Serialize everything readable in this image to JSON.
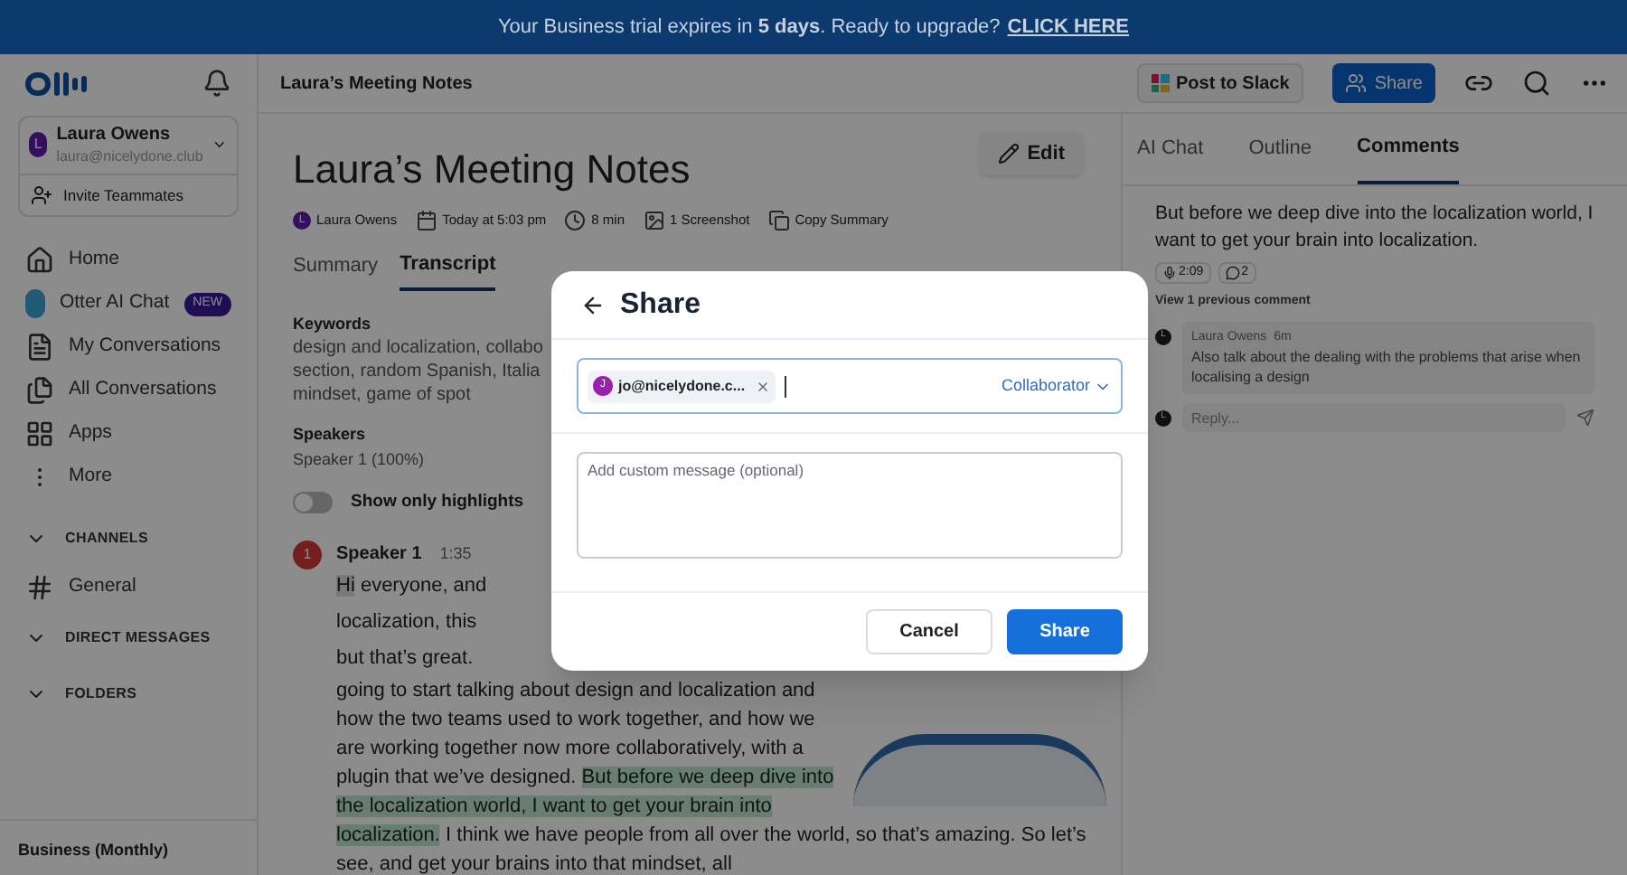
{
  "banner": {
    "text": "Your Business trial expires in **5 days**. Ready to upgrade?",
    "link": "CLICK HERE"
  },
  "sidebar": {
    "user": {
      "initial": "L",
      "name": "Laura Owens",
      "email": "laura@nicelydone.club"
    },
    "invite": "Invite Teammates",
    "nav": [
      {
        "kind": "home",
        "label": "Home"
      },
      {
        "kind": "otter",
        "label": "Otter AI Chat",
        "badge": "NEW"
      },
      {
        "kind": "doc",
        "label": "My Conversations"
      },
      {
        "kind": "docs",
        "label": "All Conversations"
      },
      {
        "kind": "apps",
        "label": "Apps"
      },
      {
        "kind": "more",
        "label": "More"
      }
    ],
    "sections": [
      {
        "label": "CHANNELS",
        "items": [
          {
            "label": "General"
          }
        ]
      },
      {
        "label": "DIRECT MESSAGES"
      },
      {
        "label": "FOLDERS"
      }
    ],
    "plan": "Business (Monthly)"
  },
  "header": {
    "title": "Laura’s Meeting Notes",
    "slack": "Post to Slack",
    "share": "Share"
  },
  "doc": {
    "title": "Laura’s Meeting Notes",
    "edit": "Edit",
    "meta": [
      {
        "kind": "owner",
        "text": "Laura Owens",
        "initial": "L"
      },
      {
        "kind": "date",
        "text": "Today at 5:03 pm"
      },
      {
        "kind": "duration",
        "text": "8 min"
      },
      {
        "kind": "screenshot",
        "text": "1 Screenshot"
      },
      {
        "kind": "copy",
        "text": "Copy Summary"
      }
    ],
    "tabs": [
      {
        "label": "Summary",
        "selected": false
      },
      {
        "label": "Transcript",
        "selected": true
      }
    ],
    "keywords_heading": "Keywords",
    "keywords": [
      "design and localization, collabo",
      "section, random Spanish, Italia",
      "mindset, game of spot"
    ],
    "speakers_heading": "Speakers",
    "speakers": "Speaker 1 (100%)",
    "highlights_toggle": {
      "label": "Show only highlights",
      "on": false
    },
    "transcript": {
      "avatar": "1",
      "speaker": "Speaker 1",
      "time": "1:35",
      "lines": [
        [
          {
            "text": "Hi",
            "kind": "selection"
          },
          {
            "text": " everyone, and",
            "kind": "plain"
          }
        ],
        [
          {
            "text": "localization, this",
            "kind": "plain"
          }
        ],
        [
          {
            "text": "but that’s great.",
            "kind": "plain"
          }
        ]
      ],
      "paragraph": [
        {
          "text": "going to start talking about design and localization and how the two teams used to work together, and how we are working together now more collaboratively, with a plugin that we’ve designed. ",
          "kind": "plain"
        },
        {
          "text": "But before we deep dive into the localization world, I want to get your brain into localization.",
          "kind": "highlight"
        },
        {
          "text": " I think we have people from all over the world, so that’s amazing. So let’s see, and get your brains into that mindset, all",
          "kind": "plain"
        }
      ]
    }
  },
  "panel": {
    "tabs": [
      {
        "label": "AI Chat",
        "selected": false
      },
      {
        "label": "Outline",
        "selected": false
      },
      {
        "label": "Comments",
        "selected": true
      }
    ],
    "quote": "But before we deep dive into the localization world, I want to get your brain into localization.",
    "time_chip": "2:09",
    "comment_count": "2",
    "view_previous": "View 1 previous comment",
    "comment": {
      "initial": "L",
      "author": "Laura Owens",
      "time": "6m",
      "text": "Also talk about the dealing with the problems that arise when localising a design"
    },
    "reply": {
      "initial": "L",
      "placeholder": "Reply..."
    }
  },
  "modal": {
    "title": "Share",
    "recipient": {
      "initial": "J",
      "email": "jo@nicelydone.c..."
    },
    "role": "Collaborator",
    "message_placeholder": "Add custom message (optional)",
    "cancel": "Cancel",
    "share": "Share"
  }
}
